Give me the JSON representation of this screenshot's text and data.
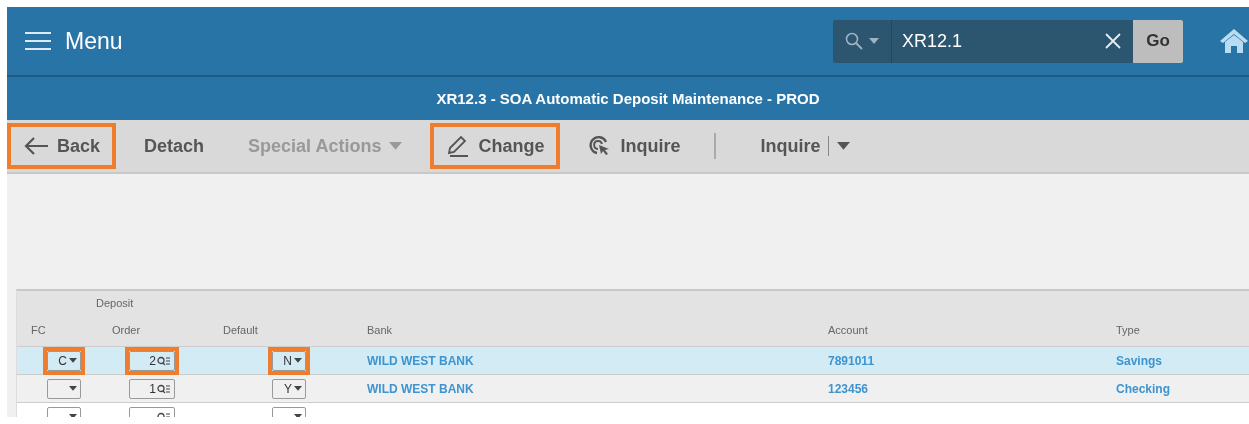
{
  "header": {
    "menu_label": "Menu",
    "search": {
      "value": "XR12.1",
      "go_label": "Go"
    }
  },
  "title_bar": {
    "title": "XR12.3 - SOA Automatic Deposit Maintenance - PROD"
  },
  "toolbar": [
    {
      "kind": "back",
      "label": "Back",
      "highlighted": true,
      "disabled": false
    },
    {
      "kind": "plain",
      "label": "Detach",
      "highlighted": false,
      "disabled": false
    },
    {
      "kind": "dropdown",
      "label": "Special Actions",
      "highlighted": false,
      "disabled": true
    },
    {
      "kind": "change",
      "label": "Change",
      "highlighted": true,
      "disabled": false
    },
    {
      "kind": "inquire",
      "label": "Inquire",
      "highlighted": false,
      "disabled": false
    },
    {
      "kind": "split",
      "label": "Inquire",
      "highlighted": false,
      "disabled": false
    }
  ],
  "table": {
    "group_heading": "Deposit",
    "columns": [
      "FC",
      "Order",
      "Default",
      "Bank",
      "Account",
      "Type"
    ],
    "rows": [
      {
        "fc": "C",
        "order": "2",
        "default": "N",
        "bank": "WILD WEST BANK",
        "account": "7891011",
        "type": "Savings",
        "selected": true,
        "highlighted": true
      },
      {
        "fc": "",
        "order": "1",
        "default": "Y",
        "bank": "WILD WEST BANK",
        "account": "123456",
        "type": "Checking",
        "selected": false,
        "highlighted": false
      },
      {
        "fc": "",
        "order": "",
        "default": "",
        "bank": "",
        "account": "",
        "type": "",
        "selected": false,
        "highlighted": false
      }
    ]
  }
}
